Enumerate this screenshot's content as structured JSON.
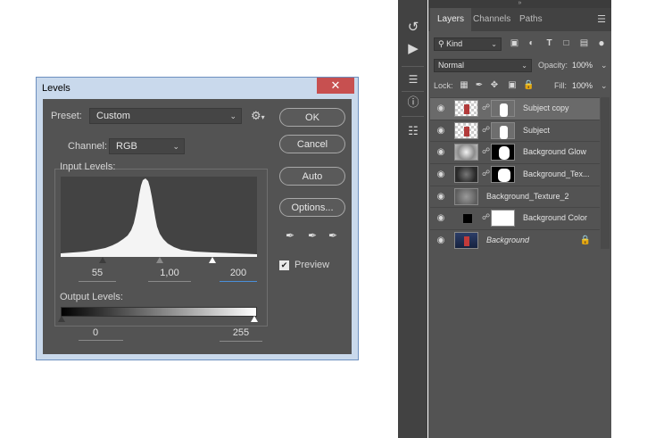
{
  "dialog": {
    "title": "Levels",
    "close_label": "✕",
    "preset_label": "Preset:",
    "preset_value": "Custom",
    "channel_label": "Channel:",
    "channel_value": "RGB",
    "input_levels_label": "Input Levels:",
    "input_black": "55",
    "input_gamma": "1,00",
    "input_white": "200",
    "output_levels_label": "Output Levels:",
    "output_black": "0",
    "output_white": "255",
    "buttons": {
      "ok": "OK",
      "cancel": "Cancel",
      "auto": "Auto",
      "options": "Options..."
    },
    "preview_label": "Preview",
    "preview_checked": true
  },
  "layers_panel": {
    "tabs": [
      "Layers",
      "Channels",
      "Paths"
    ],
    "active_tab": "Layers",
    "filter_kind": "Kind",
    "blend_mode": "Normal",
    "opacity_label": "Opacity:",
    "opacity_value": "100%",
    "lock_label": "Lock:",
    "fill_label": "Fill:",
    "fill_value": "100%",
    "layers": [
      {
        "name": "Subject copy",
        "selected": true,
        "italic": false
      },
      {
        "name": "Subject",
        "selected": false,
        "italic": false
      },
      {
        "name": "Background Glow",
        "selected": false,
        "italic": false
      },
      {
        "name": "Background_Tex...",
        "selected": false,
        "italic": false
      },
      {
        "name": "Background_Texture_2",
        "selected": false,
        "italic": false
      },
      {
        "name": "Background Color",
        "selected": false,
        "italic": false
      },
      {
        "name": "Background",
        "selected": false,
        "italic": true,
        "locked": true
      }
    ]
  },
  "colors": {
    "panel_bg": "#535353",
    "selected_row": "#6a6a6a",
    "active_field": "#4a8fd9"
  }
}
